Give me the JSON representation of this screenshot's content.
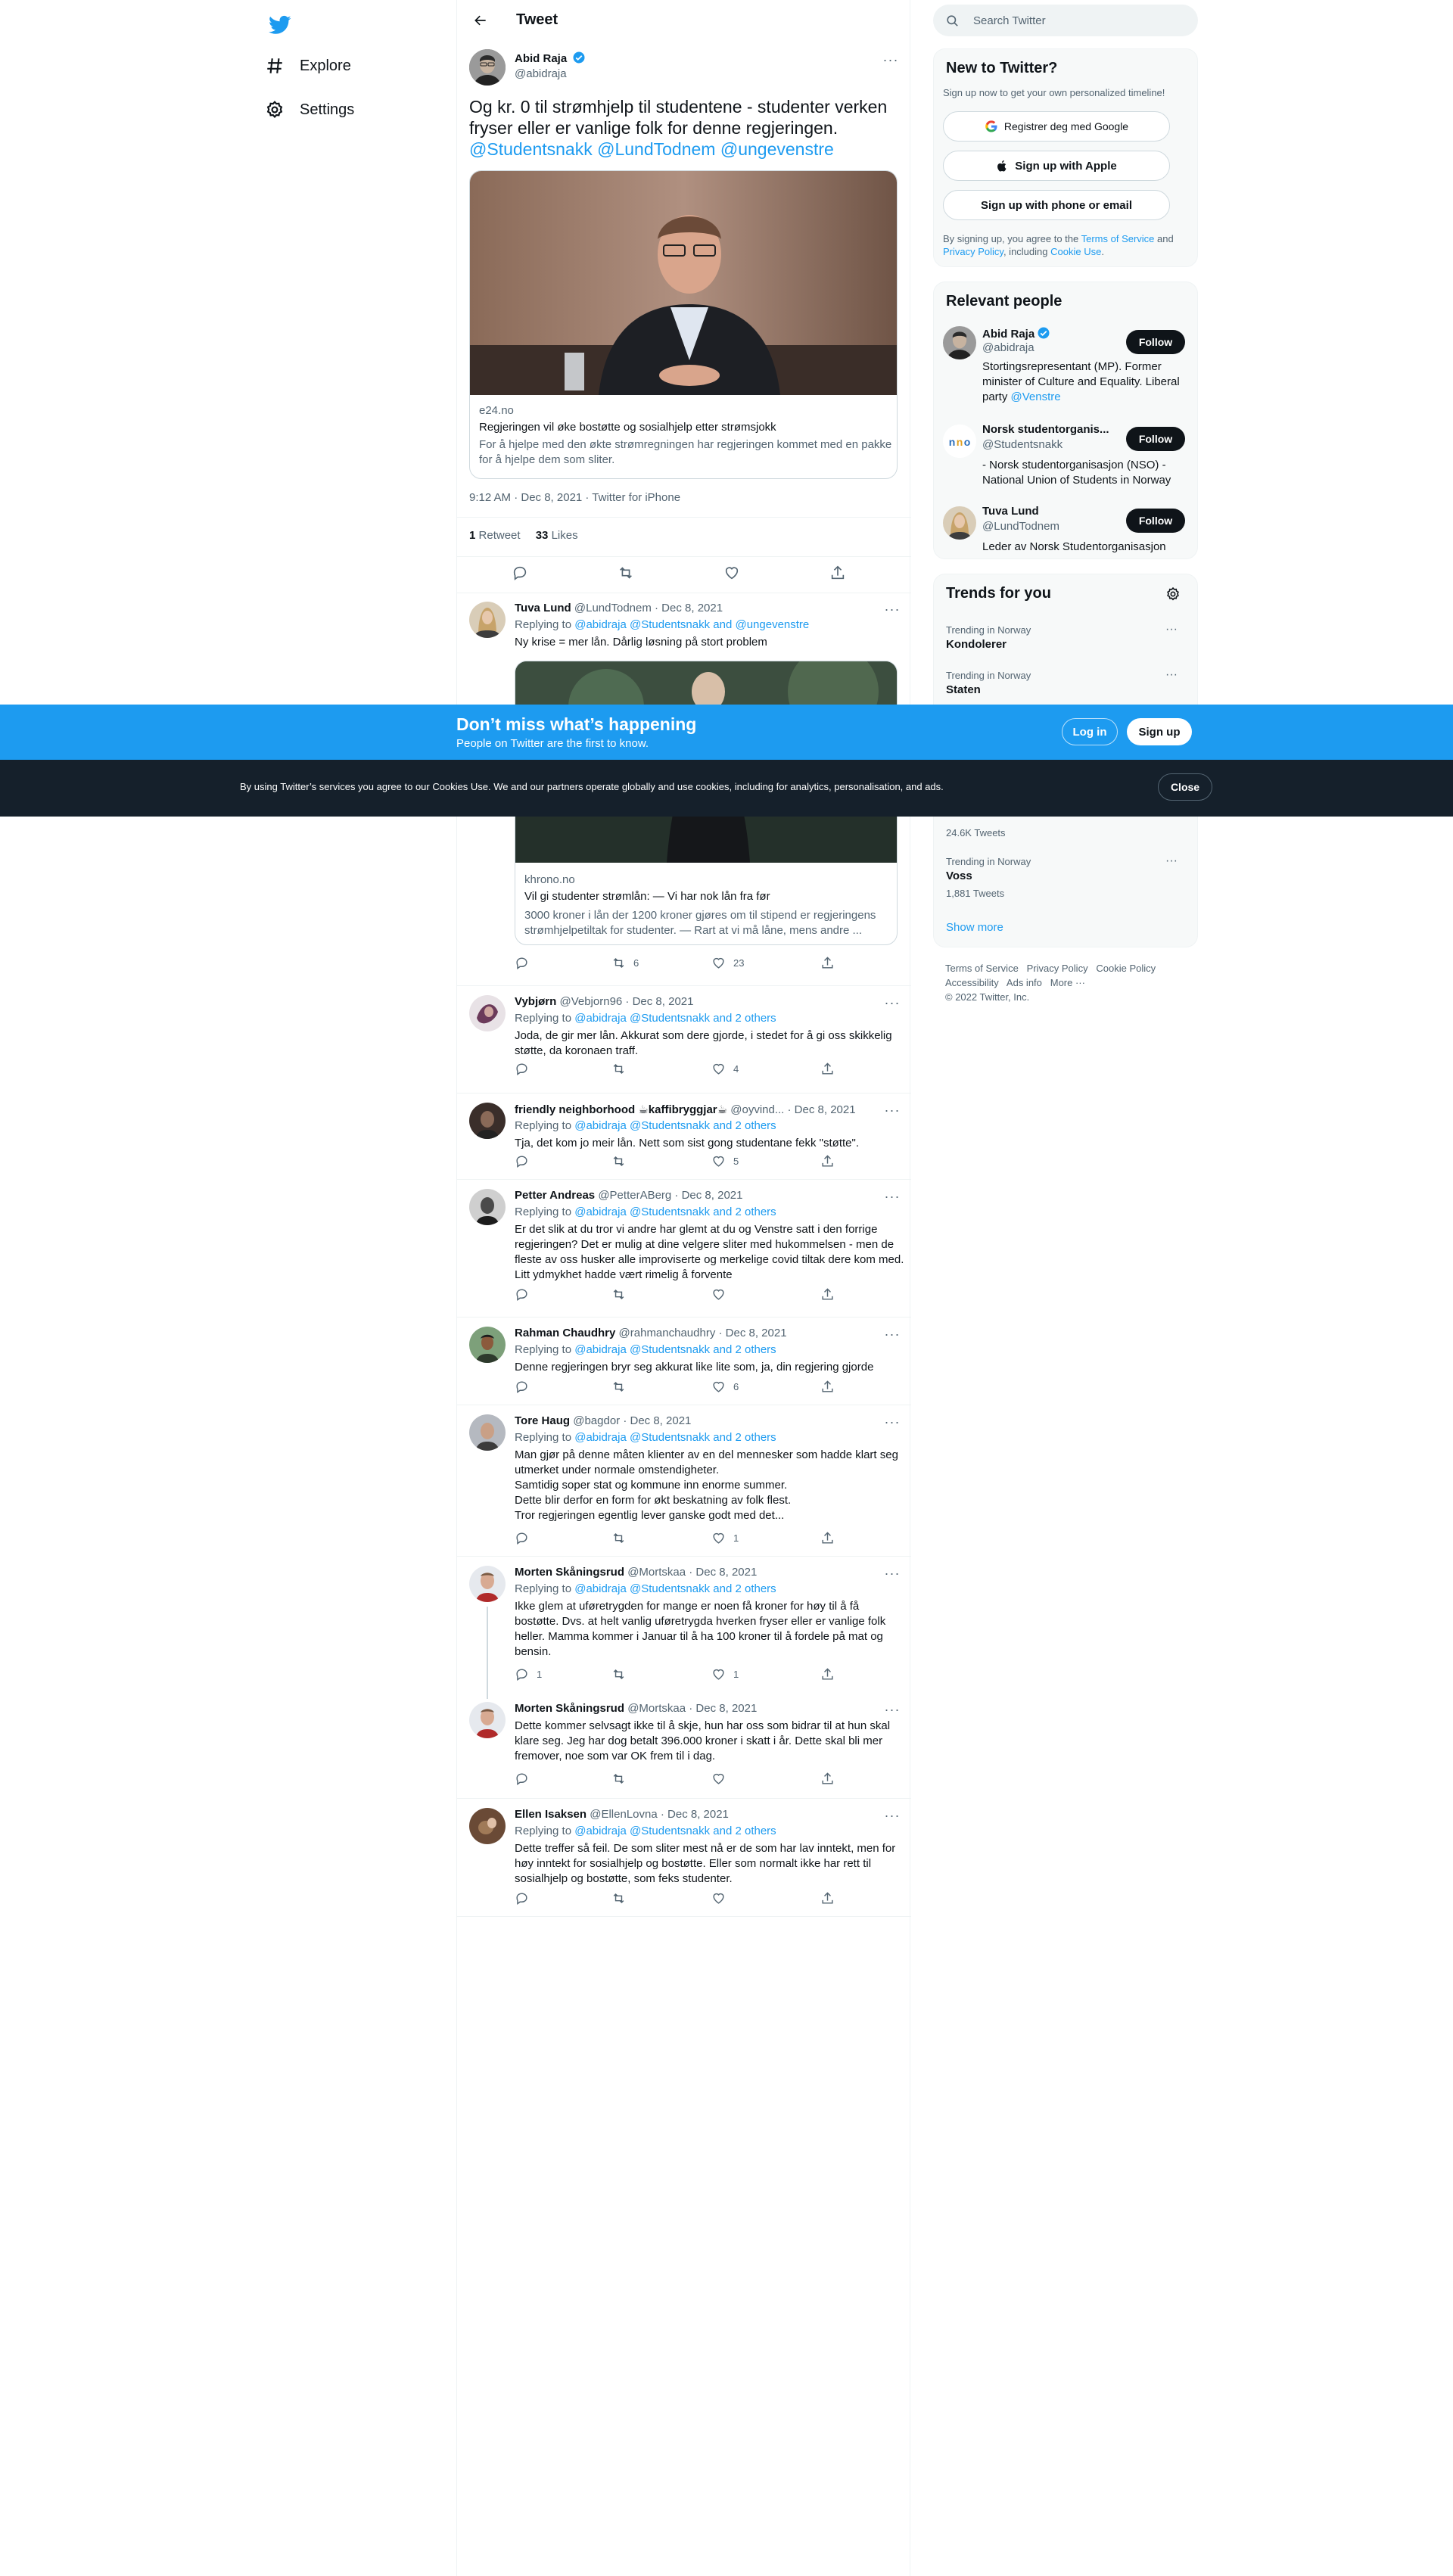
{
  "nav": {
    "explore": "Explore",
    "settings": "Settings"
  },
  "header": {
    "title": "Tweet"
  },
  "main_tweet": {
    "name": "Abid Raja",
    "handle": "@abidraja",
    "text_line1": "Og kr. 0 til strømhjelp til studentene - studenter verken",
    "text_line2": "fryser eller er vanlige folk for denne regjeringen.",
    "mention1": "@Studentsnakk",
    "mention2": "@LundTodnem",
    "mention3": "@ungevenstre",
    "card": {
      "domain": "e24.no",
      "title": "Regjeringen vil øke bostøtte og sosialhjelp etter strømsjokk",
      "desc_line1": "For å hjelpe med den økte strømregningen har regjeringen kommet med en pakke",
      "desc_line2": "for å hjelpe dem som sliter."
    },
    "timestamp": "9:12 AM · Dec 8, 2021 · Twitter for iPhone",
    "retweets_count": "1",
    "retweets_label": "Retweet",
    "likes_count": "33",
    "likes_label": "Likes"
  },
  "replies": [
    {
      "name": "Tuva Lund",
      "meta": "@LundTodnem · Dec 8, 2021",
      "replying_prefix": "Replying to ",
      "replying_to": "@abidraja @Studentsnakk and @ungevenstre",
      "text": "Ny krise = mer lån. Dårlig løsning på stort problem",
      "card": {
        "domain": "khrono.no",
        "title": "Vil gi studenter strømlån: — Vi har nok lån fra før",
        "desc_line1": "3000 kroner i lån der 1200 kroner gjøres om til stipend er regjeringens",
        "desc_line2": "strømhjelpetiltak for studenter. — Rart at vi må låne, mens andre ..."
      },
      "reply_count": "",
      "retweet_count": "6",
      "like_count": "23"
    },
    {
      "name": "Vybjørn",
      "meta": "@Vebjorn96 · Dec 8, 2021",
      "replying_prefix": "Replying to ",
      "replying_to": "@abidraja @Studentsnakk and 2 others",
      "text": "Joda, de gir mer lån. Akkurat som dere gjorde, i stedet for å gi oss skikkelig støtte, da koronaen traff.",
      "reply_count": "",
      "retweet_count": "",
      "like_count": "4"
    },
    {
      "name": "friendly neighborhood ☕kaffibryggjar☕",
      "meta": "@oyvind... · Dec 8, 2021",
      "replying_prefix": "Replying to ",
      "replying_to": "@abidraja @Studentsnakk and 2 others",
      "text": "Tja, det kom jo meir lån. Nett som sist gong studentane fekk \"støtte\".",
      "reply_count": "",
      "retweet_count": "",
      "like_count": "5"
    },
    {
      "name": "Petter Andreas",
      "meta": "@PetterABerg · Dec 8, 2021",
      "replying_prefix": "Replying to ",
      "replying_to": "@abidraja @Studentsnakk and 2 others",
      "text": "Er det slik at du tror vi andre har glemt at du og Venstre satt i den forrige regjeringen?  Det er mulig at dine velgere sliter med hukommelsen - men de fleste av oss husker alle improviserte og merkelige covid tiltak dere kom med. Litt ydmykhet hadde vært rimelig å forvente",
      "reply_count": "",
      "retweet_count": "",
      "like_count": ""
    },
    {
      "name": "Rahman Chaudhry",
      "meta": "@rahmanchaudhry · Dec 8, 2021",
      "replying_prefix": "Replying to ",
      "replying_to": "@abidraja @Studentsnakk and 2 others",
      "text": "Denne regjeringen bryr seg akkurat like lite som, ja, din regjering gjorde",
      "reply_count": "",
      "retweet_count": "",
      "like_count": "6"
    },
    {
      "name": "Tore Haug",
      "meta": "@bagdor · Dec 8, 2021",
      "replying_prefix": "Replying to ",
      "replying_to": "@abidraja @Studentsnakk and 2 others",
      "text_lines": [
        "Man gjør på denne måten klienter av en del mennesker som hadde klart seg",
        "utmerket under normale omstendigheter.",
        "Samtidig soper stat og kommune inn enorme summer.",
        "Dette blir derfor en form for økt beskatning av folk flest.",
        "Tror regjeringen egentlig lever ganske godt med det..."
      ],
      "reply_count": "",
      "retweet_count": "",
      "like_count": "1"
    },
    {
      "name": "Morten Skåningsrud",
      "meta": "@Mortskaa · Dec 8, 2021",
      "replying_prefix": "Replying to ",
      "replying_to": "@abidraja @Studentsnakk and 2 others",
      "text": "Ikke glem at uføretrygden for mange er noen få kroner for høy til å få bostøtte. Dvs. at helt vanlig uføretrygda hverken fryser eller er vanlige folk heller. Mamma kommer i Januar til å ha 100 kroner til å fordele på mat og bensin.",
      "reply_count": "1",
      "retweet_count": "",
      "like_count": "1"
    },
    {
      "name": "Morten Skåningsrud",
      "meta": "@Mortskaa · Dec 8, 2021",
      "text": "Dette kommer selvsagt ikke til å skje, hun har oss som bidrar til at hun skal klare seg. Jeg har dog betalt 396.000 kroner i skatt i år. Dette skal bli mer fremover, noe som var OK frem til i dag.",
      "reply_count": "",
      "retweet_count": "",
      "like_count": ""
    },
    {
      "name": "Ellen Isaksen",
      "meta": "@EllenLovna · Dec 8, 2021",
      "replying_prefix": "Replying to ",
      "replying_to": "@abidraja @Studentsnakk and 2 others",
      "text": "Dette treffer så feil. De som sliter mest nå er de som har lav inntekt, men for høy inntekt for sosialhjelp og bostøtte. Eller som normalt ikke har rett til sosialhjelp og bostøtte, som feks studenter.",
      "reply_count": "",
      "retweet_count": "",
      "like_count": ""
    }
  ],
  "search": {
    "placeholder": "Search Twitter"
  },
  "new_to_twitter": {
    "title": "New to Twitter?",
    "subtitle": "Sign up now to get your own personalized timeline!",
    "google_button": "Registrer deg med Google",
    "apple_button": "Sign up with Apple",
    "phone_button": "Sign up with phone or email",
    "legal_prefix": "By signing up, you agree to the ",
    "terms_link": "Terms of Service",
    "legal_and": " and",
    "privacy_link": "Privacy Policy",
    "legal_including": ", including ",
    "cookie_link": "Cookie Use",
    "legal_end": "."
  },
  "relevant_people": {
    "title": "Relevant people",
    "follow_label": "Follow",
    "people": [
      {
        "name": "Abid Raja",
        "handle": "@abidraja",
        "bio_prefix": "Stortingsrepresentant (MP). Former minister of Culture and Equality. Liberal party ",
        "bio_link": "@Venstre"
      },
      {
        "name": "Norsk studentorganis...",
        "handle": "@Studentsnakk",
        "bio_prefix": "- Norsk studentorganisasjon (NSO) - National Union of Students in Norway",
        "bio_link": ""
      },
      {
        "name": "Tuva Lund",
        "handle": "@LundTodnem",
        "bio_prefix": "Leder av Norsk Studentorganisasjon",
        "bio_link": ""
      }
    ]
  },
  "trends": {
    "title": "Trends for you",
    "items": [
      {
        "context": "Trending in Norway",
        "name": "Kondolerer",
        "count": ""
      },
      {
        "context": "Trending in Norway",
        "name": "Staten",
        "count": ""
      },
      {
        "context": "",
        "name": "",
        "count": "24.6K Tweets"
      },
      {
        "context": "Trending in Norway",
        "name": "Voss",
        "count": "1,881 Tweets"
      }
    ],
    "show_more": "Show more"
  },
  "footer": {
    "links": [
      "Terms of Service",
      "Privacy Policy",
      "Cookie Policy",
      "Accessibility",
      "Ads info",
      "More ···"
    ],
    "copyright": "© 2022 Twitter, Inc."
  },
  "banner": {
    "title": "Don’t miss what’s happening",
    "subtitle": "People on Twitter are the first to know.",
    "login": "Log in",
    "signup": "Sign up"
  },
  "cookie_bar": {
    "text": "By using Twitter’s services you agree to our Cookies Use. We and our partners operate globally and use cookies, including for analytics, personalisation, and ads.",
    "close": "Close"
  },
  "colors": {
    "accent": "#1d9bf0",
    "text": "#0f1419",
    "muted": "#536471",
    "cookie_bg": "#15202b"
  }
}
